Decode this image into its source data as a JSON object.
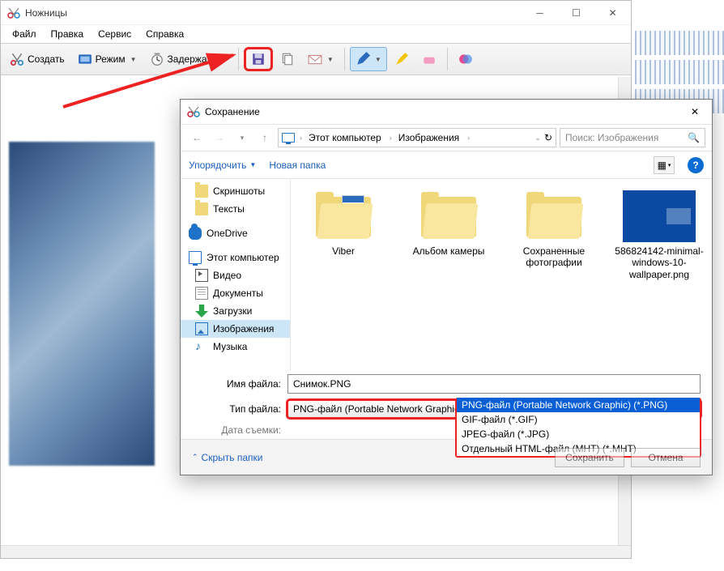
{
  "app": {
    "title": "Ножницы",
    "menu": [
      "Файл",
      "Правка",
      "Сервис",
      "Справка"
    ],
    "toolbar": {
      "new_label": "Создать",
      "mode_label": "Режим",
      "delay_label": "Задержать"
    }
  },
  "dialog": {
    "title": "Сохранение",
    "breadcrumb": [
      "Этот компьютер",
      "Изображения"
    ],
    "search_placeholder": "Поиск: Изображения",
    "organize": "Упорядочить",
    "new_folder": "Новая папка",
    "tree": {
      "screenshots": "Скриншоты",
      "texts": "Тексты",
      "onedrive": "OneDrive",
      "this_pc": "Этот компьютер",
      "videos": "Видео",
      "documents": "Документы",
      "downloads": "Загрузки",
      "pictures": "Изображения",
      "music": "Музыка"
    },
    "files": [
      {
        "name": "Viber",
        "type": "folder_docs"
      },
      {
        "name": "Альбом камеры",
        "type": "folder"
      },
      {
        "name": "Сохраненные фотографии",
        "type": "folder"
      },
      {
        "name": "586824142-minimal-windows-10-wallpaper.png",
        "type": "image"
      }
    ],
    "label_filename": "Имя файла:",
    "label_filetype": "Тип файла:",
    "label_date": "Дата съемки:",
    "filename_value": "Снимок.PNG",
    "filetype_selected": "PNG-файл (Portable Network Graphic) (*.PNG)",
    "filetype_options": [
      "PNG-файл (Portable Network Graphic) (*.PNG)",
      "GIF-файл (*.GIF)",
      "JPEG-файл (*.JPG)",
      "Отдельный HTML-файл (MHT) (*.MHT)"
    ],
    "hide_folders": "Скрыть папки",
    "btn_save": "Сохранить",
    "btn_cancel": "Отмена"
  }
}
